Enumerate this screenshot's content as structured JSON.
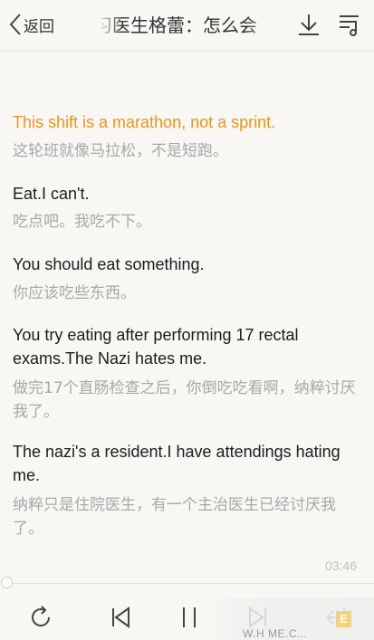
{
  "header": {
    "back_label": "返回",
    "title": "习医生格蕾：怎么会"
  },
  "lyrics": [
    {
      "en": "This shift is a marathon, not a sprint.",
      "zh": "这轮班就像马拉松，不是短跑。",
      "active": true
    },
    {
      "en": "Eat.I can't.",
      "zh": "吃点吧。我吃不下。",
      "active": false
    },
    {
      "en": "You should eat something.",
      "zh": "你应该吃些东西。",
      "active": false
    },
    {
      "en": "You try eating after performing 17 rectal exams.The Nazi hates me.",
      "zh": "做完17个直肠检查之后，你倒吃吃看啊，纳粹讨厌我了。",
      "active": false
    },
    {
      "en": "The nazi's a resident.I have attendings hating me.",
      "zh": "纳粹只是住院医生，有一个主治医生已经讨厌我了。",
      "active": false
    }
  ],
  "player": {
    "time": "03:46",
    "progress": 0.0
  },
  "watermark": {
    "text": "W.H      ME.C...",
    "badge": "E"
  },
  "colors": {
    "active_line": "#f0931e",
    "translation": "#a8a8a8",
    "background": "#f8f7f4"
  }
}
